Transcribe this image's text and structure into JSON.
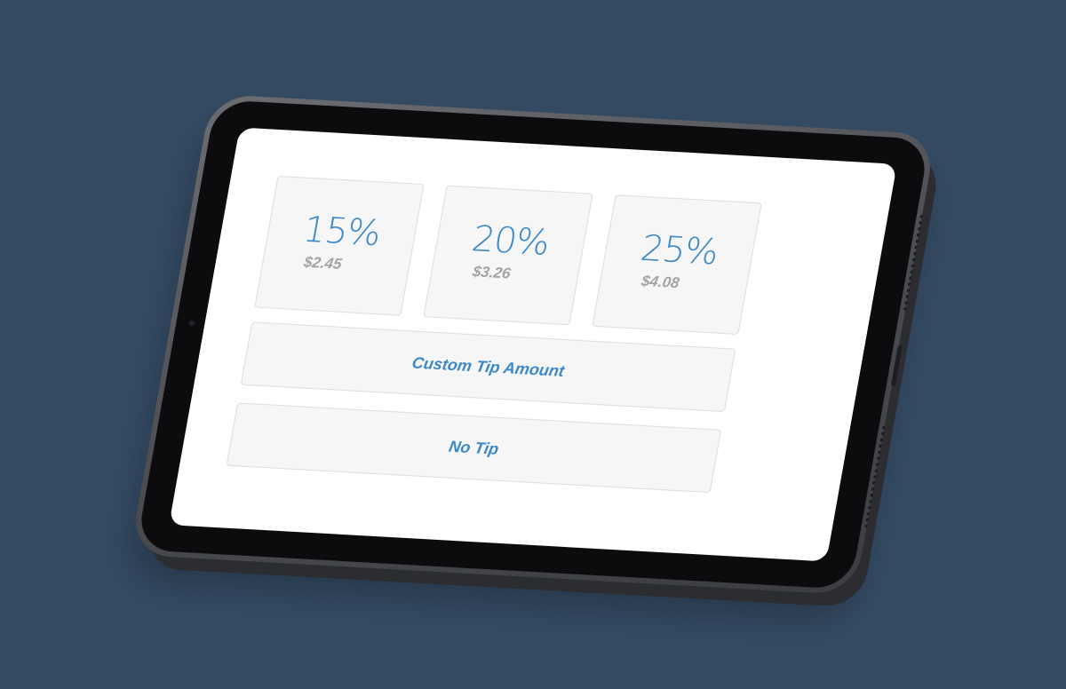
{
  "tip_options": [
    {
      "percent": "15%",
      "amount": "$2.45"
    },
    {
      "percent": "20%",
      "amount": "$3.26"
    },
    {
      "percent": "25%",
      "amount": "$4.08"
    }
  ],
  "custom_tip_label": "Custom Tip Amount",
  "no_tip_label": "No Tip",
  "colors": {
    "background": "#344b63",
    "accent": "#3a88c7",
    "amount_text": "#a3a3a3",
    "button_fill": "#f6f6f6"
  }
}
